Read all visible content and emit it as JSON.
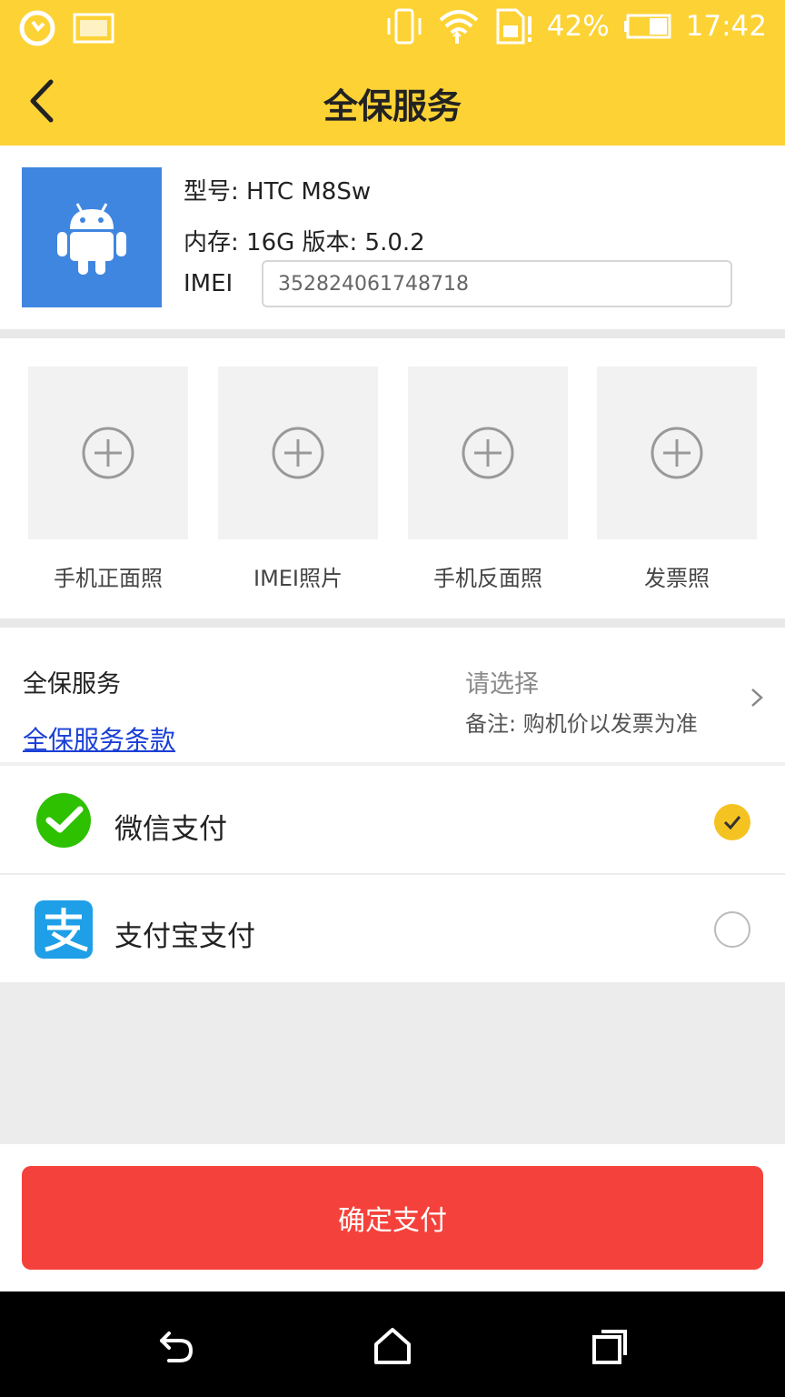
{
  "status_bar": {
    "battery_percent": "42%",
    "time": "17:42",
    "icons": [
      "sync-icon",
      "image-icon",
      "vibrate-icon",
      "wifi-icon",
      "sim-alert-icon",
      "battery-icon"
    ]
  },
  "app_bar": {
    "title": "全保服务",
    "back_icon": "chevron-left-icon"
  },
  "device": {
    "icon": "android-icon",
    "model_line": "型号:  HTC M8Sw",
    "memory_line": "内存:  16G    版本:  5.0.2",
    "imei_label": "IMEI",
    "imei_value": "352824061748718"
  },
  "photos": [
    {
      "label": "手机正面照"
    },
    {
      "label": "IMEI照片"
    },
    {
      "label": "手机反面照"
    },
    {
      "label": "发票照"
    }
  ],
  "service": {
    "title": "全保服务",
    "terms_link": "全保服务条款",
    "select_placeholder": "请选择",
    "note": "备注: 购机价以发票为准"
  },
  "payments": [
    {
      "label": "微信支付",
      "icon": "wechat-pay-icon",
      "selected": true
    },
    {
      "label": "支付宝支付",
      "icon": "alipay-icon",
      "selected": false
    }
  ],
  "confirm_button": "确定支付",
  "nav_bar": [
    "back-nav-icon",
    "home-nav-icon",
    "recents-nav-icon"
  ],
  "colors": {
    "header": "#FDD235",
    "confirm": "#F5413B",
    "check": "#F5C321",
    "android_tile": "#3F86E0",
    "wechat": "#2DC100",
    "alipay": "#1E9FE8",
    "link": "#1a3fd6"
  }
}
